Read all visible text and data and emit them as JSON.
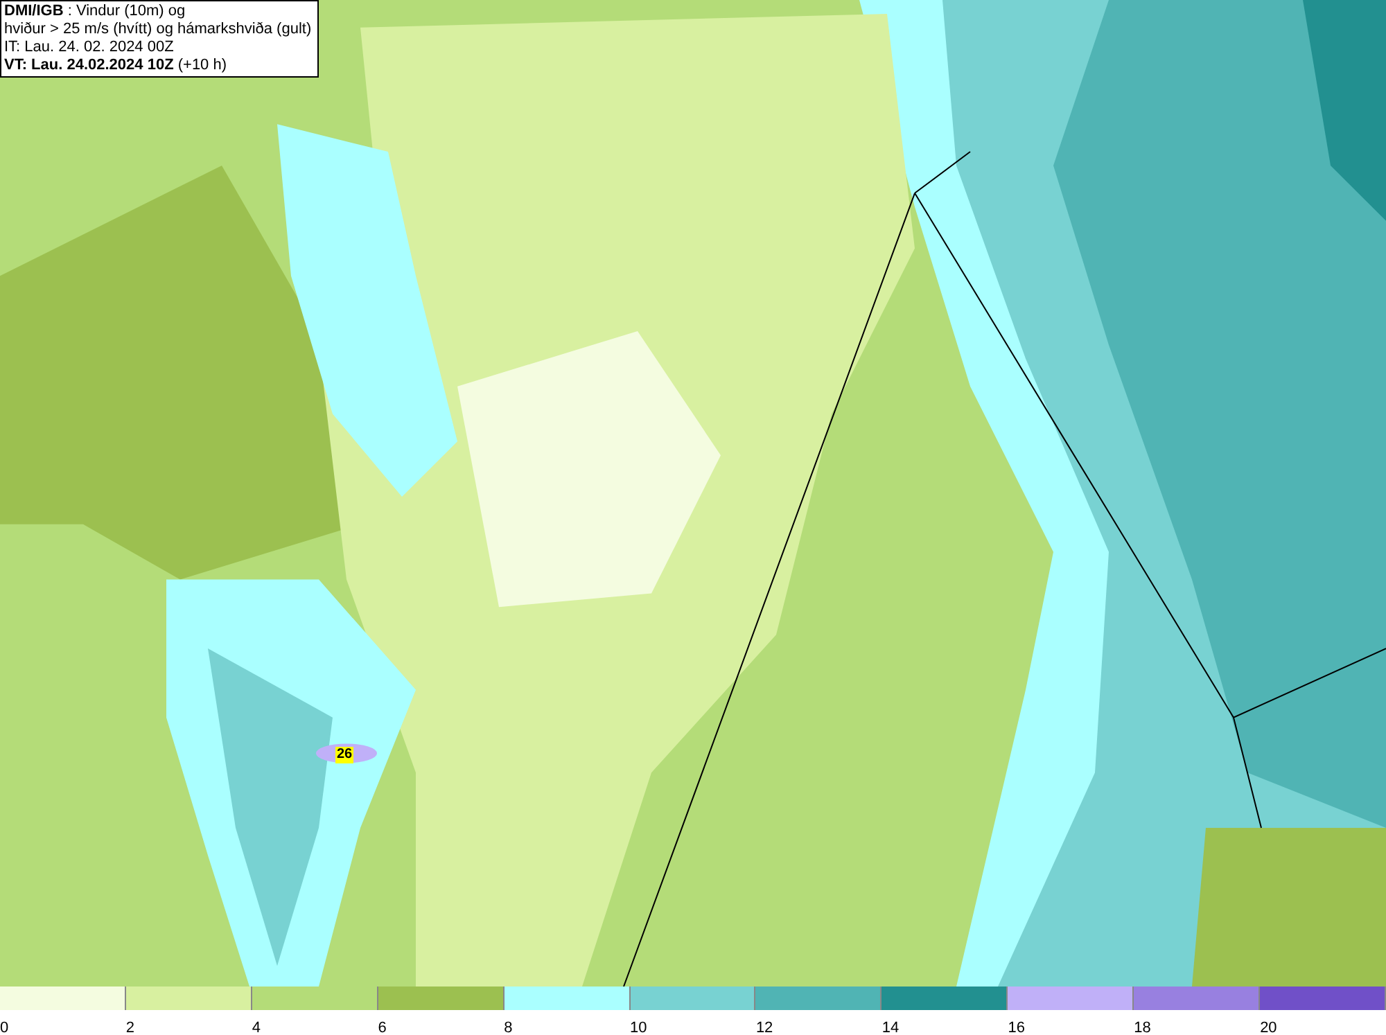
{
  "header": {
    "lines": [
      "**DMI/IGB** : Vindur (10m) og",
      "hviður > 25 m/s (hvítt) og hámarkshviða (gult)",
      "IT: Lau. 24. 02. 2024 00Z",
      "**VT: Lau. 24.02.2024 10Z** (+10 h)"
    ]
  },
  "map": {
    "gust_labels": [
      {
        "text": "26"
      }
    ]
  },
  "legend": {
    "bins": [
      {
        "color": "#f4fce0",
        "label": "0"
      },
      {
        "color": "#d8f0a0",
        "label": "2"
      },
      {
        "color": "#b4dc78",
        "label": "4"
      },
      {
        "color": "#9cc050",
        "label": "6"
      },
      {
        "color": "#aaffff",
        "label": "8"
      },
      {
        "color": "#78d2d2",
        "label": "10"
      },
      {
        "color": "#50b4b4",
        "label": "12"
      },
      {
        "color": "#229090",
        "label": "14"
      },
      {
        "color": "#c0b0f8",
        "label": "16"
      },
      {
        "color": "#9880e0",
        "label": "18"
      },
      {
        "color": "#7050c8",
        "label": "20"
      }
    ]
  }
}
